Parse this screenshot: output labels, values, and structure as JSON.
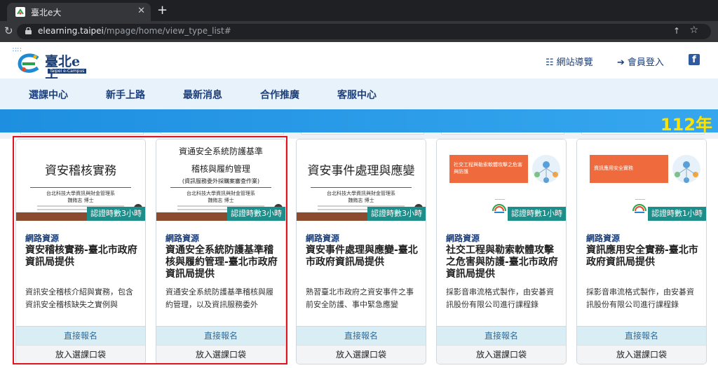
{
  "browser": {
    "tab_title": "臺北e大",
    "tab_close": "✕",
    "new_tab": "+",
    "url_host": "elearning.taipei",
    "url_path": "/mpage/home/view_type_list#"
  },
  "site": {
    "logo_name": "臺北e大",
    "logo_sub": "Taipei e-Campus",
    "header_links": [
      {
        "label": "網站導覽",
        "icon": "sitemap-icon"
      },
      {
        "label": "會員登入",
        "icon": "login-icon"
      }
    ],
    "facebook_icon": "f",
    "nav": [
      "選課中心",
      "新手上路",
      "最新消息",
      "合作推廣",
      "客服中心"
    ],
    "banner_year": "112年"
  },
  "courses": [
    {
      "thumb_title": "資安稽核實務",
      "thumb_sub": [
        "台北科技大學資訊與財金管理系",
        "魏銪志 博士"
      ],
      "badge": "認證時數3小時",
      "category": "網路資源",
      "title": "資安稽核實務-臺北市政府資訊局提供",
      "desc": "資訊安全稽核介紹與實務，包含資訊安全稽核缺失之實例與",
      "apply": "直接報名",
      "cart": "放入選課口袋"
    },
    {
      "thumb_title_lines": [
        "資通安全系統防護基準",
        "稽核與履約管理",
        "(資訊服務委外採購案審查作業)"
      ],
      "thumb_sub": [
        "台北科技大學資訊與財金管理系",
        "魏銪志 博士"
      ],
      "badge": "認證時數3小時",
      "category": "網路資源",
      "title": "資通安全系統防護基準稽核與履約管理-臺北市政府資訊局提供",
      "desc": "資通安全系統防護基準稽核與履約管理，以及資訊服務委外",
      "apply": "直接報名",
      "cart": "放入選課口袋"
    },
    {
      "thumb_title": "資安事件處理與應變",
      "thumb_sub": [
        "台北科技大學資訊與財金管理系",
        "魏銪志 博士"
      ],
      "badge": "認證時數3小時",
      "category": "網路資源",
      "title": "資安事件處理與應變-臺北市政府資訊局提供",
      "desc": "熟習臺北市政府之資安事件之事前安全防護、事中緊急應變",
      "apply": "直接報名",
      "cart": "放入選課口袋"
    },
    {
      "thumb_box": "社交工程與勒索軟體攻擊之危害與防護",
      "badge": "認證時數1小時",
      "category": "網路資源",
      "title": "社交工程與勒索軟體攻擊之危害與防護-臺北市政府資訊局提供",
      "desc": "採影音串流格式製作，由安碁資訊股份有限公司進行課程錄",
      "apply": "直接報名",
      "cart": "放入選課口袋"
    },
    {
      "thumb_box": "資訊應用安全實務",
      "badge": "認證時數1小時",
      "category": "網路資源",
      "title": "資訊應用安全實務-臺北市政府資訊局提供",
      "desc": "採影音串流格式製作，由安碁資訊股份有限公司進行課程錄",
      "apply": "直接報名",
      "cart": "放入選課口袋"
    }
  ],
  "colors": {
    "accent": "#1c3f7a",
    "badge": "#1d8e8a",
    "banner": "#1e8fe0",
    "year": "#ffe300",
    "highlight": "#e0141c"
  }
}
